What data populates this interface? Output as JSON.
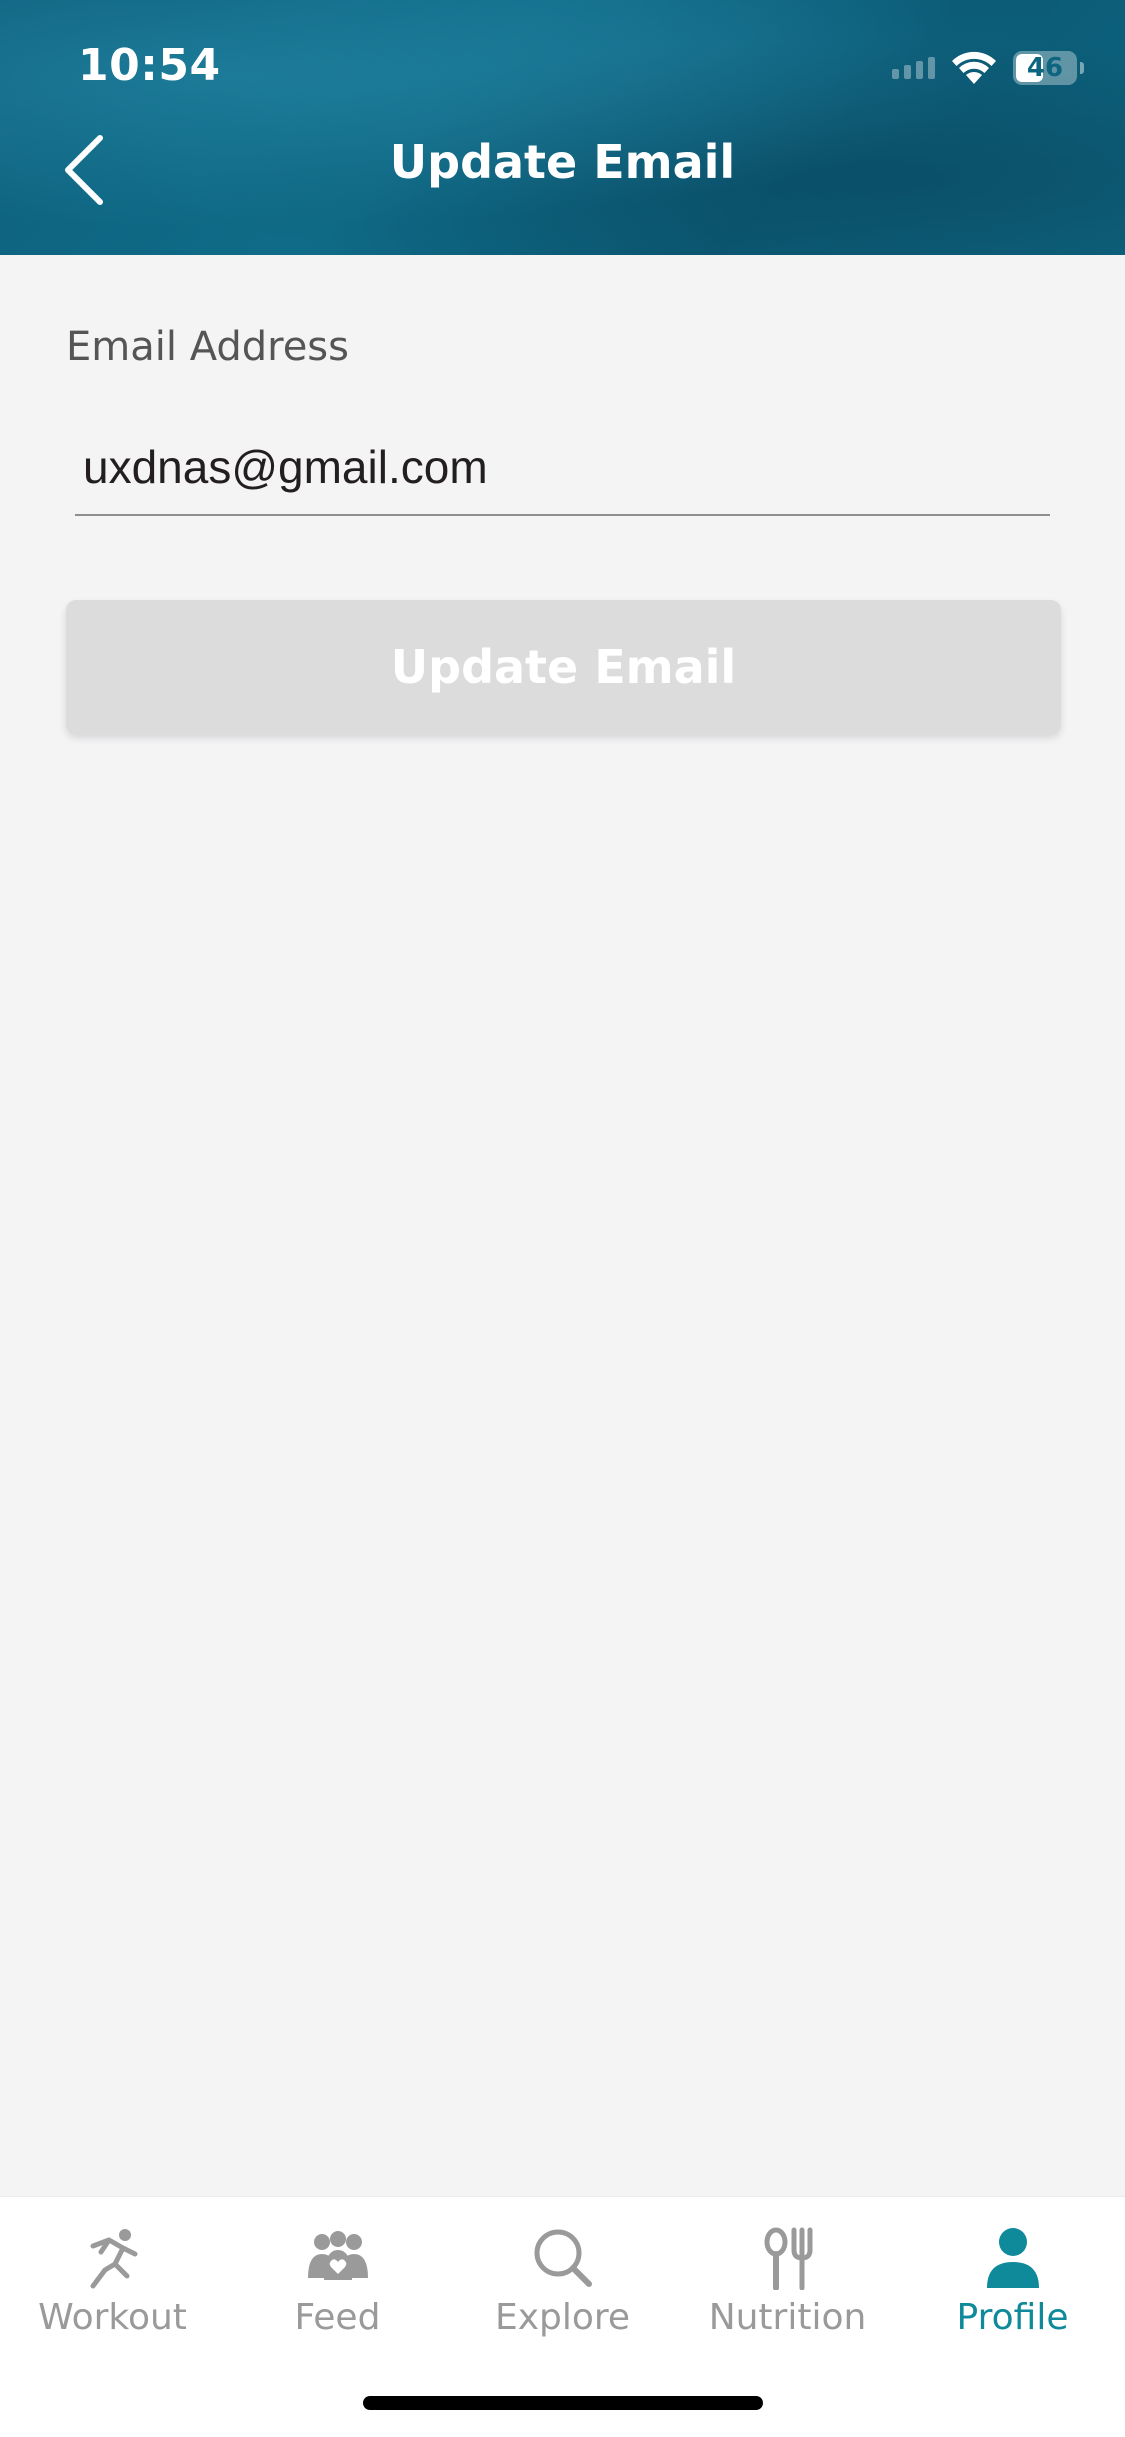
{
  "status_bar": {
    "time": "10:54",
    "battery": "46",
    "battery_level": 0.46
  },
  "header": {
    "title": "Update Email",
    "back_icon": "chevron-left-icon"
  },
  "form": {
    "email_label": "Email Address",
    "email_value": "uxdnas@gmail.com",
    "submit_label": "Update Email",
    "submit_enabled": false
  },
  "tab_bar": {
    "active_color": "#0f8a9b",
    "inactive_color": "#9a9a9a",
    "tabs": [
      {
        "label": "Workout",
        "icon": "running-person-icon",
        "active": false
      },
      {
        "label": "Feed",
        "icon": "people-heart-icon",
        "active": false
      },
      {
        "label": "Explore",
        "icon": "magnifier-icon",
        "active": false
      },
      {
        "label": "Nutrition",
        "icon": "fork-spoon-icon",
        "active": false
      },
      {
        "label": "Profile",
        "icon": "person-icon",
        "active": true
      }
    ]
  }
}
